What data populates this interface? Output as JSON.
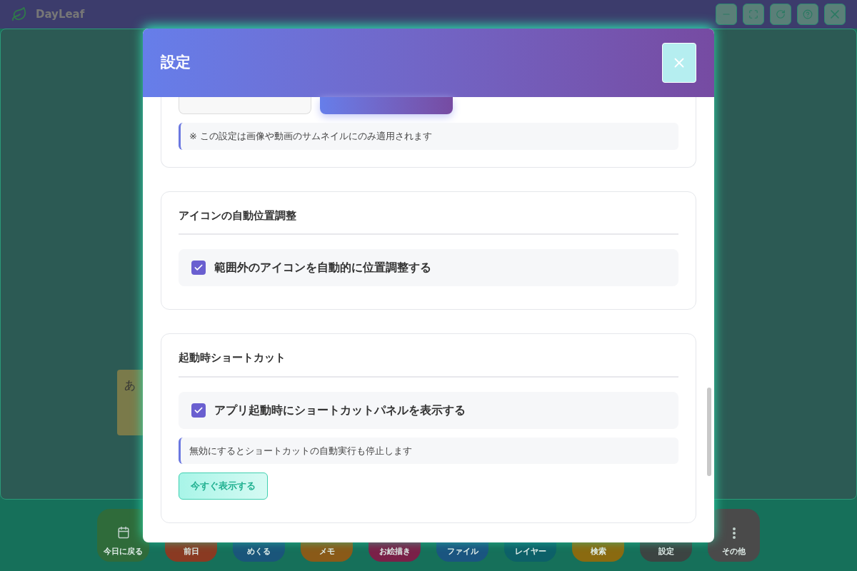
{
  "app": {
    "title": "DayLeaf"
  },
  "window_controls": [
    {
      "kind": "minimize"
    },
    {
      "kind": "fullscreen"
    },
    {
      "kind": "reload"
    },
    {
      "kind": "help"
    },
    {
      "kind": "close"
    }
  ],
  "note": {
    "text": "あ"
  },
  "toolbar": [
    {
      "label": "今日に戻る",
      "color": "#2f6b3a",
      "kind": "calendar"
    },
    {
      "label": "前日",
      "color": "#8a3a22",
      "kind": "plain"
    },
    {
      "label": "めくる",
      "color": "#1a557a",
      "kind": "plain"
    },
    {
      "label": "メモ",
      "color": "#8a5a18",
      "kind": "plain"
    },
    {
      "label": "お絵描き",
      "color": "#7a2048",
      "kind": "plain"
    },
    {
      "label": "ファイル",
      "color": "#1a5580",
      "kind": "plain"
    },
    {
      "label": "レイヤー",
      "color": "#0d6068",
      "kind": "plain"
    },
    {
      "label": "検索",
      "color": "#8a6a10",
      "kind": "plain"
    },
    {
      "label": "設定",
      "color": "#3c4442",
      "kind": "plain"
    },
    {
      "label": "その他",
      "color": "#4a4a4a",
      "kind": "more"
    }
  ],
  "dialog": {
    "title": "設定",
    "size_options": [
      {
        "selected": false
      },
      {
        "selected": true
      }
    ],
    "size_note": "※ この設定は画像や動画のサムネイルにのみ適用されます",
    "sections": [
      {
        "title": "アイコンの自動位置調整",
        "checkbox": {
          "label": "範囲外のアイコンを自動的に位置調整する",
          "checked": true
        }
      },
      {
        "title": "起動時ショートカット",
        "checkbox": {
          "label": "アプリ起動時にショートカットパネルを表示する",
          "checked": true
        },
        "note": "無効にするとショートカットの自動実行も停止します",
        "button": "今すぐ表示する"
      }
    ]
  }
}
